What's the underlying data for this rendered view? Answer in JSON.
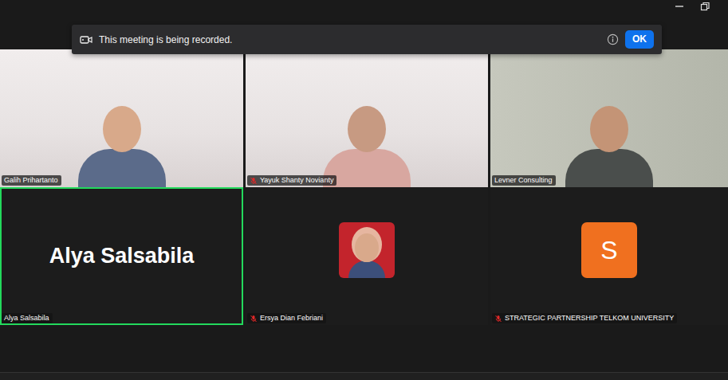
{
  "banner": {
    "message": "This meeting is being recorded.",
    "button": "OK"
  },
  "participants": [
    {
      "name": "Galih Prihartanto",
      "kind": "video",
      "muted": false,
      "active_speaker": false
    },
    {
      "name": "Yayuk Shanty Novianty",
      "kind": "video",
      "muted": true,
      "active_speaker": false
    },
    {
      "name": "Levner Consulting",
      "kind": "video",
      "muted": false,
      "active_speaker": false
    },
    {
      "name": "Alya Salsabila",
      "kind": "name",
      "muted": false,
      "active_speaker": true
    },
    {
      "name": "Ersya Dian Febriani",
      "kind": "avatar",
      "muted": true,
      "active_speaker": false
    },
    {
      "name": "STRATEGIC PARTNERSHIP TELKOM UNIVERSITY",
      "kind": "initial",
      "initial": "S",
      "muted": true,
      "active_speaker": false
    }
  ]
}
